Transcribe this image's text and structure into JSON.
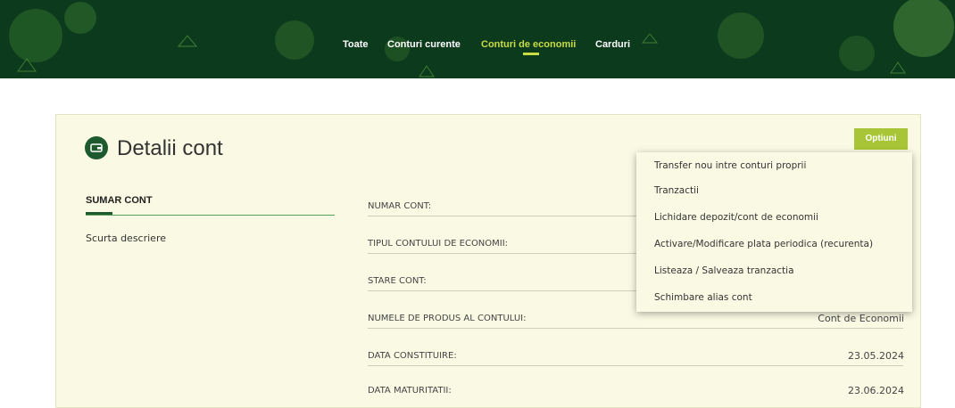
{
  "nav": {
    "items": [
      "Toate",
      "Conturi curente",
      "Conturi de economii",
      "Carduri"
    ],
    "active_index": 2
  },
  "colors": {
    "header_bg": "#0c3a1d",
    "accent": "#c8dc45",
    "options_button": "#a7c536",
    "card_bg": "#fafae4",
    "brand_green": "#1e5a2e"
  },
  "page": {
    "title": "Detalii cont",
    "title_icon": "wallet-icon",
    "options_label": "Optiuni"
  },
  "summary": {
    "heading": "SUMAR CONT",
    "description": "Scurta descriere"
  },
  "details": {
    "rows": [
      {
        "label": "NUMAR CONT:",
        "value": ""
      },
      {
        "label": "TIPUL CONTULUI DE ECONOMII:",
        "value": ""
      },
      {
        "label": "STARE CONT:",
        "value": ""
      },
      {
        "label": "NUMELE DE PRODUS AL CONTULUI:",
        "value": "Cont de Economii"
      },
      {
        "label": "DATA CONSTITUIRE:",
        "value": "23.05.2024"
      },
      {
        "label": "DATA MATURITATII:",
        "value": "23.06.2024"
      }
    ]
  },
  "options_menu": {
    "items": [
      "Transfer nou intre conturi proprii",
      "Tranzactii",
      "Lichidare depozit/cont de economii",
      "Activare/Modificare plata periodica (recurenta)",
      "Listeaza / Salveaza tranzactia",
      "Schimbare alias cont"
    ]
  }
}
